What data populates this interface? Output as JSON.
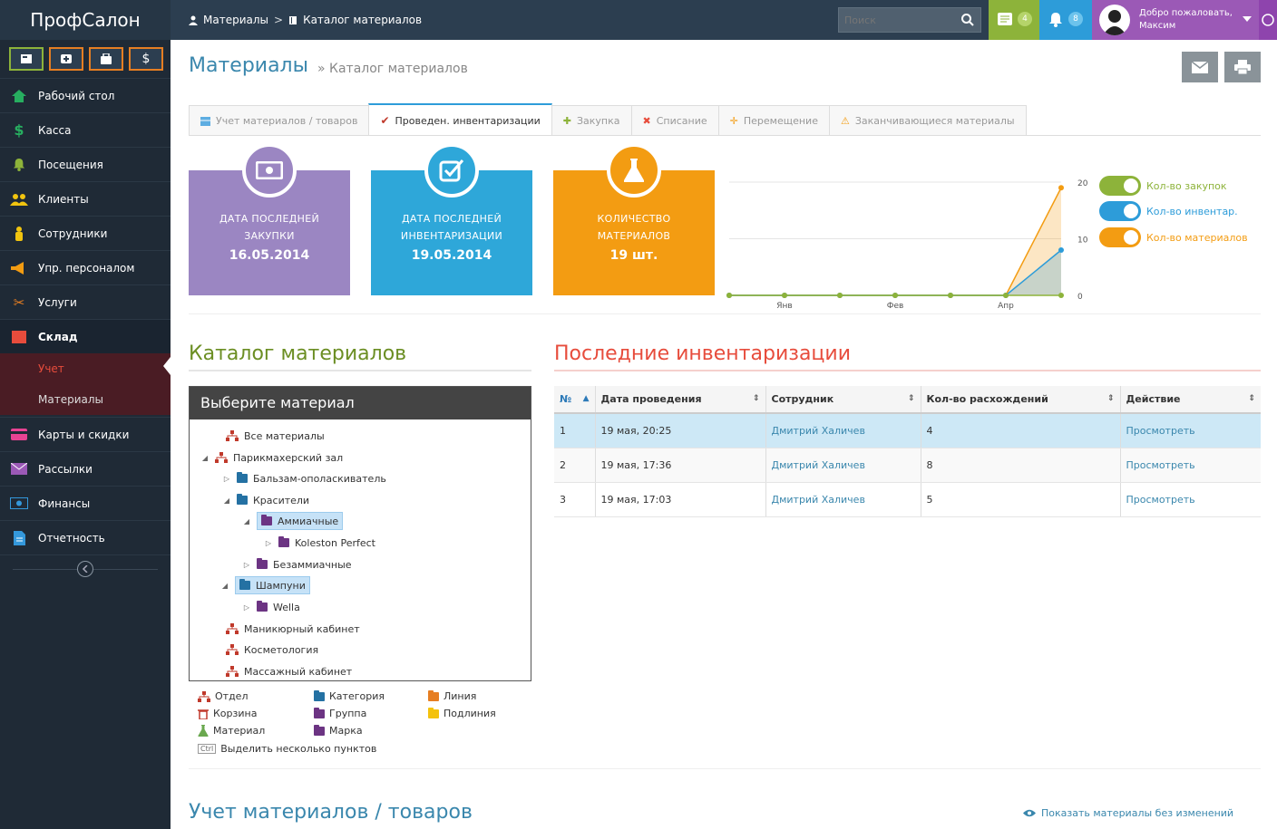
{
  "app": {
    "brand": "ПрофСалон"
  },
  "breadcrumb": {
    "item1": "Материалы",
    "sep": ">",
    "item2": "Каталог материалов"
  },
  "search": {
    "placeholder": "Поиск"
  },
  "notifications": {
    "messages_count": "4",
    "alerts_count": "8"
  },
  "user": {
    "greeting": "Добро пожаловать,",
    "name": "Максим"
  },
  "quick_buttons": [
    {
      "icon": "cash-icon"
    },
    {
      "icon": "plus-icon"
    },
    {
      "icon": "bag-icon"
    },
    {
      "icon": "dollar-icon",
      "label": "$"
    }
  ],
  "sidebar": {
    "items": [
      {
        "label": "Рабочий стол",
        "icon": "home-icon"
      },
      {
        "label": "Касса",
        "icon": "dollar-icon"
      },
      {
        "label": "Посещения",
        "icon": "bell-icon"
      },
      {
        "label": "Клиенты",
        "icon": "users-icon"
      },
      {
        "label": "Сотрудники",
        "icon": "person-icon"
      },
      {
        "label": "Упр. персоналом",
        "icon": "megaphone-icon"
      },
      {
        "label": "Услуги",
        "icon": "scissors-icon"
      },
      {
        "label": "Склад",
        "icon": "warehouse-icon"
      },
      {
        "label": "Карты и скидки",
        "icon": "card-icon"
      },
      {
        "label": "Рассылки",
        "icon": "envelope-icon"
      },
      {
        "label": "Финансы",
        "icon": "money-icon"
      },
      {
        "label": "Отчетность",
        "icon": "report-icon"
      }
    ],
    "subitems": [
      {
        "label": "Учет"
      },
      {
        "label": "Материалы"
      }
    ]
  },
  "page": {
    "title": "Материалы",
    "subtitle": "» Каталог материалов"
  },
  "tabs": [
    {
      "label": "Учет материалов / товаров",
      "icon": "table-icon"
    },
    {
      "label": "Проведен. инвентаризации",
      "icon": "check-icon"
    },
    {
      "label": "Закупка",
      "icon": "plus-icon"
    },
    {
      "label": "Списание",
      "icon": "cross-icon"
    },
    {
      "label": "Перемещение",
      "icon": "move-icon"
    },
    {
      "label": "Заканчивающиеся материалы",
      "icon": "warning-icon"
    }
  ],
  "cards": [
    {
      "label": "Дата последней закупки",
      "value": "16.05.2014",
      "color": "#9b86c2"
    },
    {
      "label": "Дата последней инвентаризации",
      "value": "19.05.2014",
      "color": "#2ea7d9"
    },
    {
      "label": "Количество материалов",
      "value": "19 шт.",
      "color": "#f39c12"
    }
  ],
  "chart_data": {
    "type": "area",
    "x": [
      "",
      "Янв",
      "",
      "Фев",
      "",
      "Апр",
      ""
    ],
    "ylim": [
      0,
      20
    ],
    "yticks": [
      "0",
      "10",
      "20"
    ],
    "series": [
      {
        "name": "Кол-во закупок",
        "color": "#8db33a",
        "values": [
          0,
          0,
          0,
          0,
          0,
          0,
          0
        ]
      },
      {
        "name": "Кол-во инвентар.",
        "color": "#2d9cd9",
        "values": [
          0,
          0,
          0,
          0,
          0,
          0,
          8
        ]
      },
      {
        "name": "Кол-во материалов",
        "color": "#f39c12",
        "values": [
          0,
          0,
          0,
          0,
          0,
          0,
          19
        ]
      }
    ]
  },
  "catalog": {
    "title": "Каталог материалов",
    "header": "Выберите материал",
    "nodes": [
      {
        "label": "Все материалы",
        "type": "dept"
      },
      {
        "label": "Парикмахерский зал",
        "type": "dept"
      },
      {
        "label": "Бальзам-ополаскиватель",
        "type": "category"
      },
      {
        "label": "Красители",
        "type": "category"
      },
      {
        "label": "Аммиачные",
        "type": "group"
      },
      {
        "label": "Koleston Perfect",
        "type": "brand"
      },
      {
        "label": "Безаммиачные",
        "type": "group"
      },
      {
        "label": "Шампуни",
        "type": "category"
      },
      {
        "label": "Wella",
        "type": "brand"
      },
      {
        "label": "Маникюрный кабинет",
        "type": "dept"
      },
      {
        "label": "Косметология",
        "type": "dept"
      },
      {
        "label": "Массажный кабинет",
        "type": "dept"
      }
    ],
    "legend": [
      {
        "label": "Отдел"
      },
      {
        "label": "Категория"
      },
      {
        "label": "Линия"
      },
      {
        "label": "Корзина"
      },
      {
        "label": "Группа"
      },
      {
        "label": "Подлиния"
      },
      {
        "label": "Материал"
      },
      {
        "label": "Марка"
      }
    ],
    "ctrl_key": "Ctrl",
    "ctrl_hint": "Выделить несколько пунктов"
  },
  "inventory": {
    "title": "Последние инвентаризации",
    "columns": [
      "№",
      "Дата проведения",
      "Сотрудник",
      "Кол-во расхождений",
      "Действие"
    ],
    "rows": [
      {
        "num": "1",
        "date": "19 мая, 20:25",
        "employee": "Дмитрий Халичев",
        "diff": "4",
        "action": "Просмотреть"
      },
      {
        "num": "2",
        "date": "19 мая, 17:36",
        "employee": "Дмитрий Халичев",
        "diff": "8",
        "action": "Просмотреть"
      },
      {
        "num": "3",
        "date": "19 мая, 17:03",
        "employee": "Дмитрий Халичев",
        "diff": "5",
        "action": "Просмотреть"
      }
    ]
  },
  "bottom": {
    "title": "Учет материалов / товаров",
    "show_link": "Показать материалы без изменений"
  }
}
